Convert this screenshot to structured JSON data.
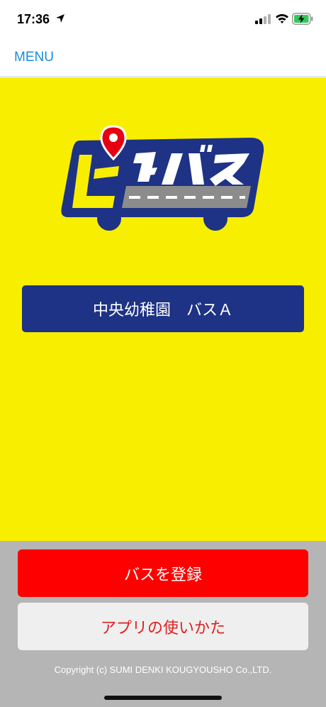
{
  "status_bar": {
    "time": "17:36"
  },
  "nav": {
    "menu_label": "MENU"
  },
  "logo": {
    "text": "ピタバス"
  },
  "bus": {
    "name": "中央幼稚園　バスＡ"
  },
  "buttons": {
    "register": "バスを登録",
    "howto": "アプリの使いかた"
  },
  "footer": {
    "copyright": "Copyright (c) SUMI DENKI KOUGYOUSHO Co.,LTD."
  },
  "colors": {
    "yellow": "#f8ee00",
    "navy": "#1e3385",
    "red": "#ff0000",
    "link_blue": "#1a8cdc",
    "gray_panel": "#b5b5b5"
  }
}
